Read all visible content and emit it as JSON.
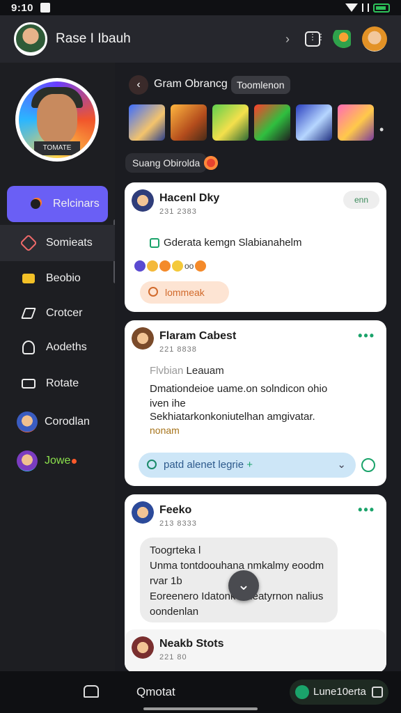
{
  "status_bar": {
    "time": "9:10"
  },
  "header": {
    "title": "Rase I Ibauh",
    "icons": [
      "back-chevron-icon",
      "gamepad-icon",
      "puzzle-icon",
      "profile-avatar"
    ]
  },
  "sidebar": {
    "profile_badge": "TOMATE",
    "items": [
      {
        "label": "Relcinars",
        "icon": "bomb-icon"
      },
      {
        "label": "Somieats",
        "icon": "hexagon-icon"
      },
      {
        "label": "Beobio",
        "icon": "bag-icon"
      },
      {
        "label": "Crotcer",
        "icon": "pencil-icon"
      },
      {
        "label": "Aodeths",
        "icon": "person-icon"
      },
      {
        "label": "Rotate",
        "icon": "screen-icon"
      },
      {
        "label": "Corodlan",
        "icon": "avatar"
      },
      {
        "label": "Jowe",
        "icon": "avatar"
      }
    ]
  },
  "group": {
    "title": "Gram Obrancg",
    "tag": "Toomlenon",
    "status": "Suang Obirolda"
  },
  "cards": [
    {
      "name": "Hacenl Dky",
      "time": "231 2383",
      "join": "enn",
      "message": "Gderata kemgn Slabianahelm",
      "reactions": "oo",
      "search_label": "lommeak"
    },
    {
      "name": "Flaram Cabest",
      "time": "221 8838",
      "subject_prefix": "Flvbian",
      "subject": "Leauam",
      "body1": "Dmationdeioe uame.on solndicon ohio iven ihe",
      "body2": "Sekhiatarkonkoniutelhan amgivatar.",
      "body3": "nonam",
      "prompt": "patd alenet legrie"
    },
    {
      "name": "Feeko",
      "time": "213 8333",
      "bubble_title": "Toogrteka l",
      "bubble_line1": "Unma tontdoouhana nmkalmy eoodm",
      "bubble_line2": "rvar 1b",
      "bubble_line3": "Eoreenero Idatonkevneatyrnon nalius",
      "bubble_line4": "oondenlan"
    }
  ],
  "sub_post": {
    "name": "Neakb Stots",
    "time": "221 80"
  },
  "bottom_nav": {
    "label": "Qmotat",
    "pill_label": "Lune10erta"
  }
}
